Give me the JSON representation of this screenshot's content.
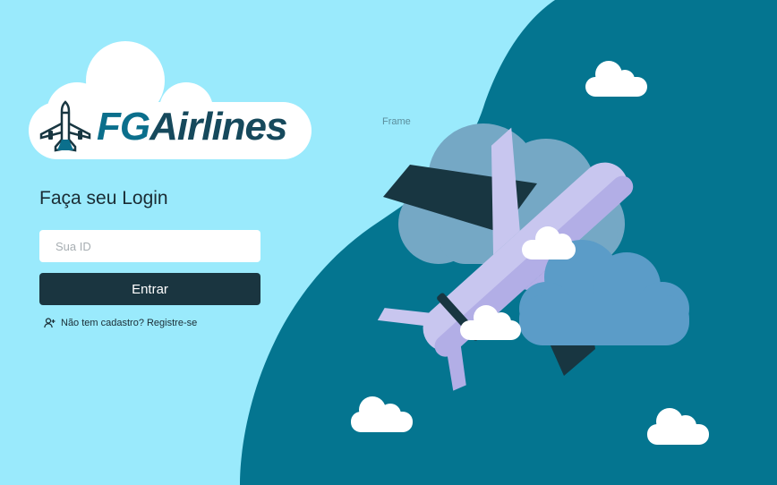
{
  "logo": {
    "prefix": "FG",
    "suffix": "Airlines"
  },
  "frame_label": "Frame",
  "login": {
    "title": "Faça seu Login",
    "id_placeholder": "Sua ID",
    "id_value": "",
    "submit_label": "Entrar",
    "register_text": "Não tem cadastro? Registre-se"
  },
  "icons": {
    "logo": "airplane-icon",
    "register": "add-user-icon"
  },
  "colors": {
    "background": "#9aeafc",
    "sea": "#047590",
    "button": "#1a3540",
    "plane_body": "#c8c6ef",
    "plane_wing_dark": "#183641"
  }
}
